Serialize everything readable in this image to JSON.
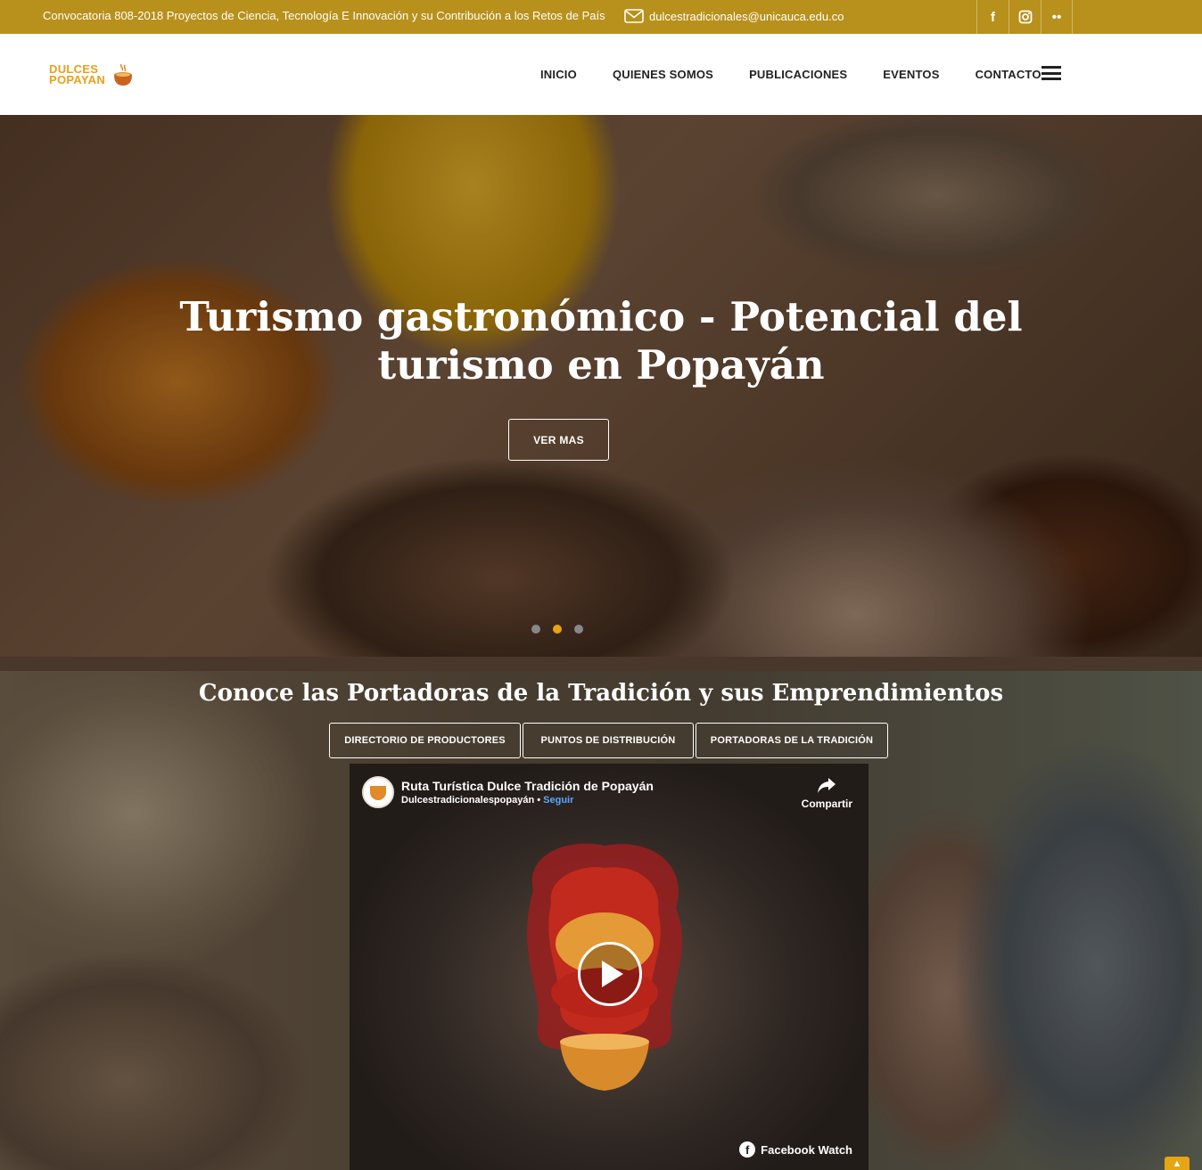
{
  "topbar": {
    "announcement": "Convocatoria 808-2018 Proyectos de Ciencia, Tecnología E Innovación y su Contribución a los Retos de País",
    "email": "dulcestradicionales@unicauca.edu.co",
    "social": [
      {
        "icon": "facebook-icon",
        "glyph": "f"
      },
      {
        "icon": "instagram-icon",
        "glyph": "◘"
      },
      {
        "icon": "flickr-icon",
        "glyph": "••"
      }
    ]
  },
  "header": {
    "logo_line1": "DULCES",
    "logo_line2": "POPAYAN",
    "nav": [
      "INICIO",
      "QUIENES SOMOS",
      "PUBLICACIONES",
      "EVENTOS",
      "CONTACTO"
    ]
  },
  "hero": {
    "title": "Turismo gastronómico - Potencial del turismo en Popayán",
    "button": "VER MAS",
    "slides": 3,
    "active_slide": 2
  },
  "section2": {
    "title": "Conoce las Portadoras de la Tradición y sus Emprendimientos",
    "tabs": [
      "DIRECTORIO DE PRODUCTORES",
      "PUNTOS DE DISTRIBUCIÓN",
      "PORTADORAS DE LA TRADICIÓN"
    ]
  },
  "video": {
    "title": "Ruta Turística Dulce Tradición de Popayán",
    "page": "Dulcestradicionalespopayán",
    "separator": "•",
    "follow": "Seguir",
    "share": "Compartir",
    "watch": "Facebook Watch"
  },
  "colors": {
    "topbar": "#b8901c",
    "accent": "#e6a512"
  }
}
